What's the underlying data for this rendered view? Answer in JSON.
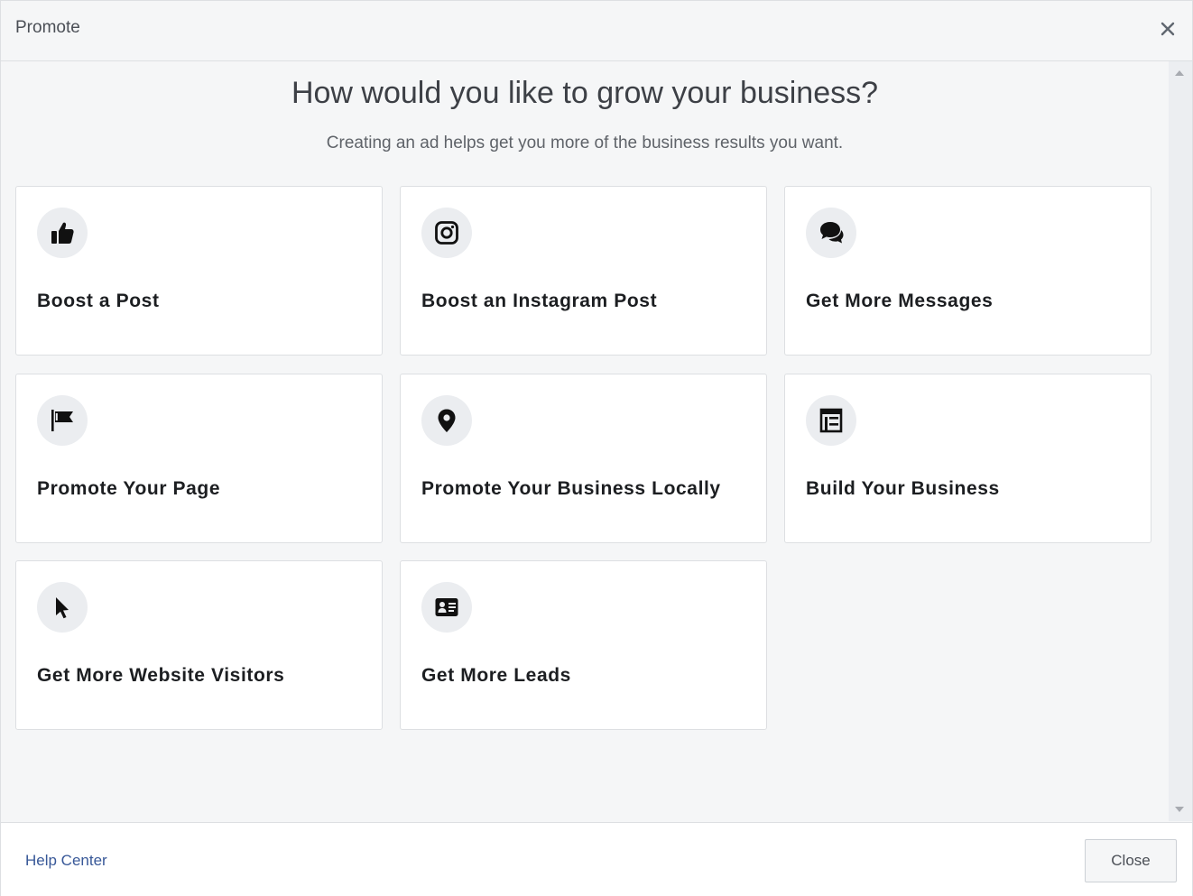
{
  "header": {
    "title": "Promote",
    "close_icon": "close-icon"
  },
  "main": {
    "heading": "How would you like to grow your business?",
    "subheading": "Creating an ad helps get you more of the business results you want.",
    "options": [
      {
        "label": "Boost a Post",
        "icon": "thumbs-up-icon"
      },
      {
        "label": "Boost an Instagram Post",
        "icon": "instagram-icon"
      },
      {
        "label": "Get More Messages",
        "icon": "chat-bubbles-icon"
      },
      {
        "label": "Promote Your Page",
        "icon": "flag-icon"
      },
      {
        "label": "Promote Your Business Locally",
        "icon": "location-pin-icon"
      },
      {
        "label": "Build Your Business",
        "icon": "storefront-icon"
      },
      {
        "label": "Get More Website Visitors",
        "icon": "cursor-icon"
      },
      {
        "label": "Get More Leads",
        "icon": "contact-card-icon"
      }
    ]
  },
  "footer": {
    "help_link": "Help Center",
    "close_label": "Close"
  },
  "colors": {
    "link": "#385898",
    "text_dark": "#1c1e21",
    "background": "#f5f6f7",
    "border": "#dddfe2"
  }
}
